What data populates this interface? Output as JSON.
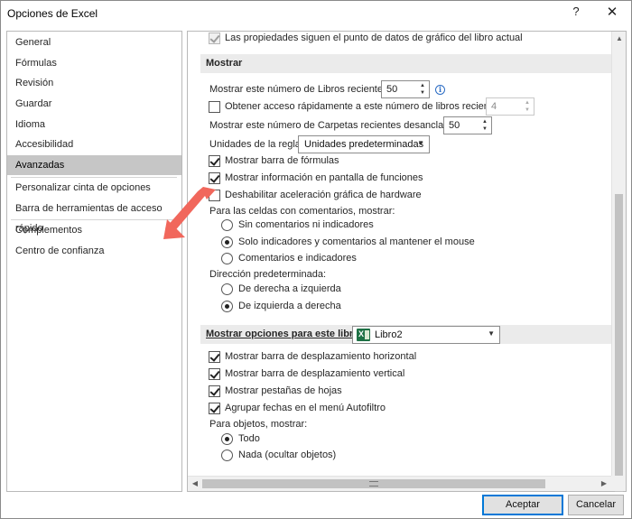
{
  "window": {
    "title": "Opciones de Excel",
    "help_label": "?",
    "close_label": "✕"
  },
  "sidebar": {
    "items": [
      {
        "label": "General",
        "selected": false
      },
      {
        "label": "Fórmulas",
        "selected": false
      },
      {
        "label": "Revisión",
        "selected": false
      },
      {
        "label": "Guardar",
        "selected": false
      },
      {
        "label": "Idioma",
        "selected": false
      },
      {
        "label": "Accesibilidad",
        "selected": false
      },
      {
        "label": "Avanzadas",
        "selected": true
      },
      {
        "label": "Personalizar cinta de opciones",
        "selected": false
      },
      {
        "label": "Barra de herramientas de acceso rápido",
        "selected": false
      },
      {
        "label": "Complementos",
        "selected": false
      },
      {
        "label": "Centro de confianza",
        "selected": false
      }
    ]
  },
  "content": {
    "top_option": {
      "label": "Las propiedades siguen el punto de datos de gráfico del libro actual",
      "checked": true,
      "disabled": true
    },
    "mostrar": {
      "header": "Mostrar",
      "recent_books": {
        "label": "Mostrar este número de Libros recientes:",
        "value": "50",
        "info_icon": "info-icon"
      },
      "quick_access": {
        "label": "Obtener acceso rápidamente a este número de libros recientes:",
        "value": "4",
        "checked": false
      },
      "recent_folders": {
        "label": "Mostrar este número de Carpetas recientes desancladas:",
        "value": "50"
      },
      "ruler_units": {
        "label": "Unidades de la regla",
        "value": "Unidades predeterminadas"
      },
      "formula_bar": {
        "label": "Mostrar barra de fórmulas",
        "checked": true
      },
      "function_screentips": {
        "label": "Mostrar información en pantalla de funciones",
        "checked": true
      },
      "disable_hw_accel": {
        "label": "Deshabilitar aceleración gráfica de hardware",
        "checked": false
      },
      "comments_label": "Para las celdas con comentarios, mostrar:",
      "comments_options": [
        {
          "label": "Sin comentarios ni indicadores",
          "checked": false
        },
        {
          "label": "Solo indicadores y comentarios al mantener el mouse",
          "checked": true
        },
        {
          "label": "Comentarios e indicadores",
          "checked": false
        }
      ],
      "direction_label": "Dirección predeterminada:",
      "direction_options": [
        {
          "label": "De derecha a izquierda",
          "checked": false
        },
        {
          "label": "De izquierda a derecha",
          "checked": true
        }
      ]
    },
    "workbook": {
      "header": "Mostrar opciones para este libro:",
      "workbook_select": "Libro2",
      "options": [
        {
          "label": "Mostrar barra de desplazamiento horizontal",
          "checked": true
        },
        {
          "label": "Mostrar barra de desplazamiento vertical",
          "checked": true
        },
        {
          "label": "Mostrar pestañas de hojas",
          "checked": true
        },
        {
          "label": "Agrupar fechas en el menú Autofiltro",
          "checked": true
        }
      ],
      "objects_label": "Para objetos, mostrar:",
      "objects_options": [
        {
          "label": "Todo",
          "checked": true
        },
        {
          "label": "Nada (ocultar objetos)",
          "checked": false
        }
      ]
    }
  },
  "buttons": {
    "accept": "Aceptar",
    "cancel": "Cancelar"
  }
}
